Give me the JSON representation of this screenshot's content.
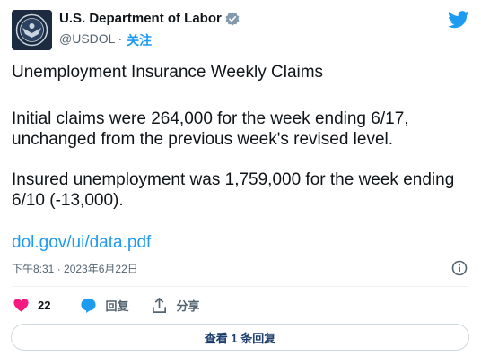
{
  "author": {
    "name": "U.S. Department of Labor",
    "handle": "@USDOL",
    "separator": "·",
    "follow_label": "关注"
  },
  "tweet": {
    "line1": "Unemployment Insurance Weekly Claims",
    "line2": "Initial claims were 264,000 for the week ending 6/17, unchanged from the previous week's revised level.",
    "line3": "Insured unemployment was 1,759,000 for the week ending 6/10 (-13,000).",
    "link": "dol.gov/ui/data.pdf",
    "timestamp": "下午8:31 · 2023年6月22日"
  },
  "actions": {
    "like_count": "22",
    "reply_label": "回复",
    "share_label": "分享"
  },
  "replies_button": "查看 1 条回复",
  "colors": {
    "accent": "#1d9bf0",
    "like": "#f91880",
    "text": "#0f1419",
    "muted": "#536471"
  },
  "icons": [
    "verified-badge-icon",
    "twitter-bird-icon",
    "info-icon",
    "heart-icon",
    "reply-bubble-icon",
    "share-icon"
  ]
}
